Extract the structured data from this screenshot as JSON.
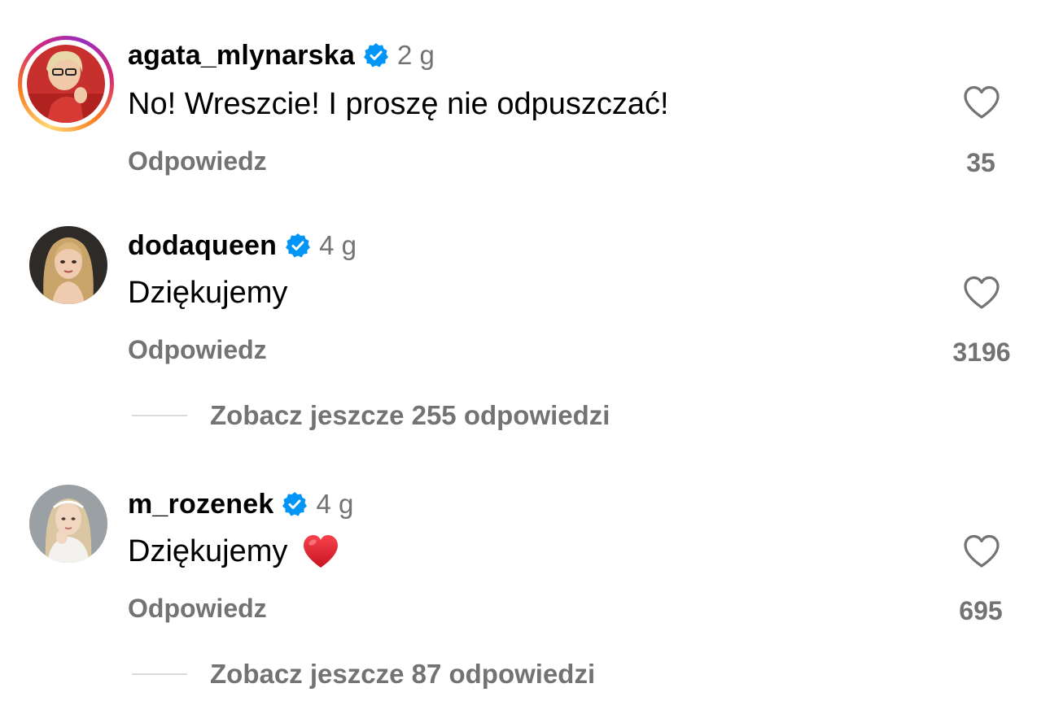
{
  "comments": [
    {
      "username": "agata_mlynarska",
      "time": "2 g",
      "text": "No! Wreszcie! I proszę nie odpuszczać!",
      "reply_label": "Odpowiedz",
      "likes": "35",
      "avatar_icon": "avatar-agata-photo",
      "has_story_ring": true
    },
    {
      "username": "dodaqueen",
      "time": "4 g",
      "text": "Dziękujemy",
      "reply_label": "Odpowiedz",
      "likes": "3196",
      "avatar_icon": "avatar-doda-photo",
      "more_replies": "Zobacz jeszcze 255 odpowiedzi"
    },
    {
      "username": "m_rozenek",
      "time": "4 g",
      "text": "Dziękujemy",
      "emoji": "red-heart-emoji",
      "reply_label": "Odpowiedz",
      "likes": "695",
      "avatar_icon": "avatar-rozenek-photo",
      "more_replies": "Zobacz jeszcze 87 odpowiedzi"
    }
  ],
  "colors": {
    "verified_blue": "#0095f6",
    "secondary_text": "#737373",
    "divider": "#dbdbdb",
    "heart_red": "#e0202a"
  }
}
